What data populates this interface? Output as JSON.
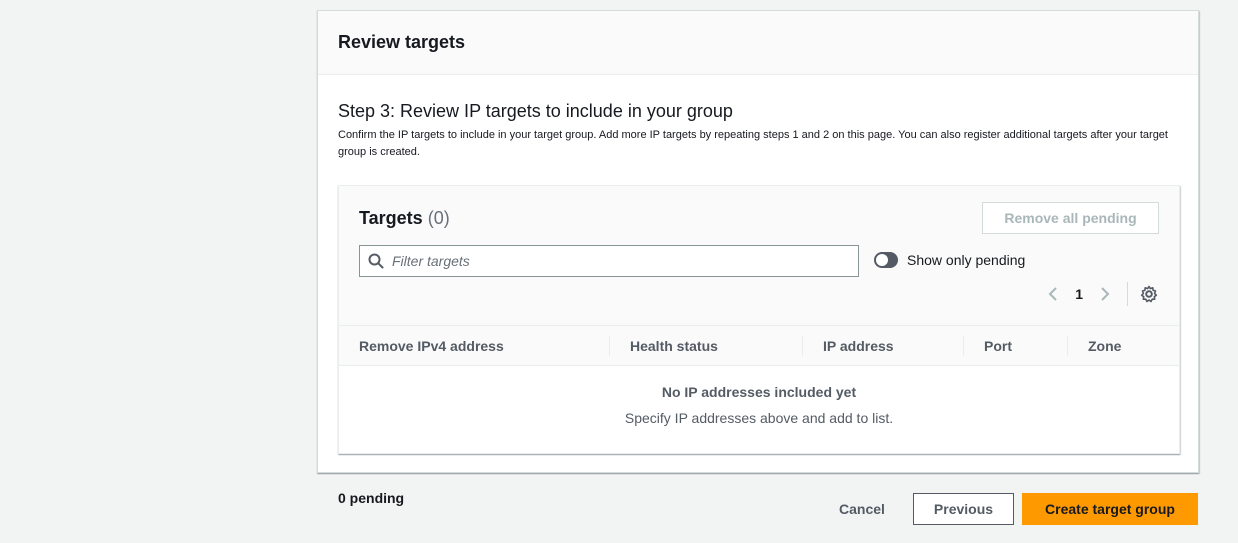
{
  "card": {
    "title": "Review targets"
  },
  "step": {
    "title": "Step 3: Review IP targets to include in your group",
    "description": "Confirm the IP targets to include in your target group. Add more IP targets by repeating steps 1 and 2 on this page. You can also register additional targets after your target group is created."
  },
  "targets": {
    "title": "Targets",
    "count": "(0)",
    "remove_all_label": "Remove all pending",
    "filter_placeholder": "Filter targets",
    "filter_value": "",
    "toggle_label": "Show only pending",
    "toggle_on": false,
    "page_number": "1",
    "columns": [
      "Remove IPv4 address",
      "Health status",
      "IP address",
      "Port",
      "Zone"
    ],
    "empty_title": "No IP addresses included yet",
    "empty_description": "Specify IP addresses above and add to list."
  },
  "footer": {
    "pending_text": "0 pending",
    "cancel_label": "Cancel",
    "previous_label": "Previous",
    "create_label": "Create target group"
  },
  "icons": {
    "search": "search-icon",
    "prev_page": "chevron-left-icon",
    "next_page": "chevron-right-icon",
    "settings": "gear-icon"
  },
  "colors": {
    "primary_button": "#ff9900",
    "page_background": "#f2f3f3",
    "text_primary": "#16191f",
    "text_secondary": "#545b64",
    "disabled_text": "#aab7b8"
  }
}
